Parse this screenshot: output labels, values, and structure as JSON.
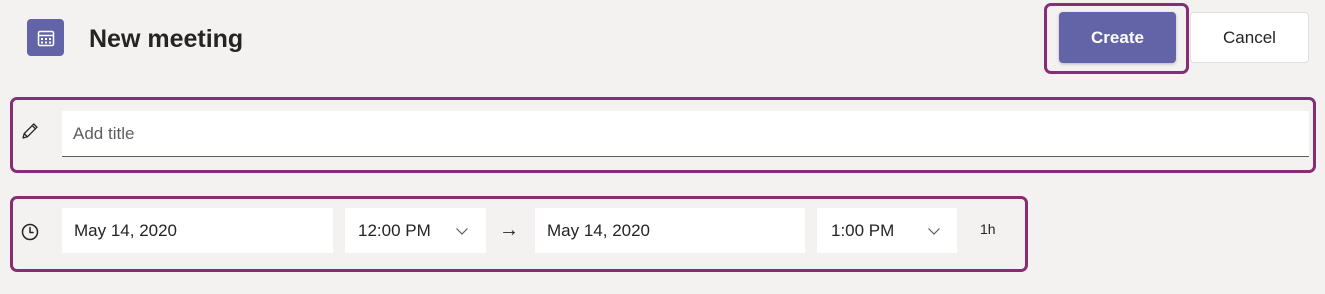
{
  "header": {
    "title": "New meeting",
    "icon": "calendar-icon",
    "accent_color": "#6264a7"
  },
  "toolbar": {
    "create_label": "Create",
    "cancel_label": "Cancel"
  },
  "title_field": {
    "placeholder": "Add title",
    "value": "",
    "icon": "pencil-icon"
  },
  "schedule": {
    "icon": "clock-icon",
    "start_date": "May 14, 2020",
    "start_time": "12:00 PM",
    "arrow": "→",
    "end_date": "May 14, 2020",
    "end_time": "1:00 PM",
    "duration": "1h"
  },
  "highlight_color": "#862d73"
}
